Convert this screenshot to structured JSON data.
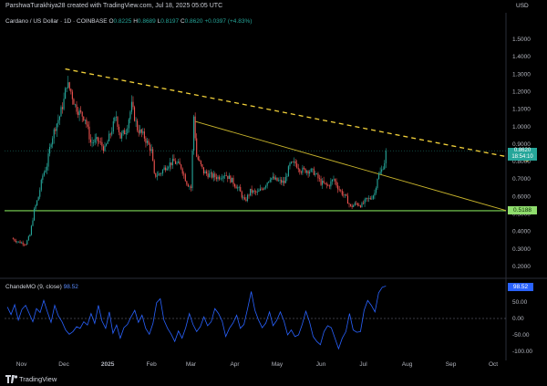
{
  "header": {
    "attribution": "ParshwaTurakhiya28 created with TradingView.com, Jul 18, 2025 05:05 UTC",
    "currency": "USD"
  },
  "legend": {
    "symbol": "Cardano / US Dollar · 1D · COINBASE",
    "o_label": "O",
    "o_value": "0.8225",
    "h_label": "H",
    "h_value": "0.8689",
    "l_label": "L",
    "l_value": "0.8197",
    "c_label": "C",
    "c_value": "0.8620",
    "change": "+0.0397 (+4.83%)"
  },
  "badges": {
    "price": "0.8620",
    "countdown": "18:54:10",
    "support": "0.5188",
    "osc": "98.52"
  },
  "oscillator": {
    "label": "ChandeMO (9, close)",
    "value": "98.52"
  },
  "footer": {
    "brand": "TradingView"
  },
  "colors": {
    "up": "#26a69a",
    "down": "#ef5350",
    "trend_dashed": "#f2d13a",
    "trend_solid": "#c9b52c",
    "support": "#7ed957",
    "osc_line": "#2962ff"
  },
  "chart_data": [
    {
      "type": "candlestick",
      "title": "Cardano / US Dollar · 1D · COINBASE",
      "y_axis_labels": [
        "1.5000",
        "1.4000",
        "1.3000",
        "1.2000",
        "1.1000",
        "1.0000",
        "0.9000",
        "0.8000",
        "0.7000",
        "0.6000",
        "0.5000",
        "0.4000",
        "0.3000",
        "0.2000"
      ],
      "ylim": [
        0.16,
        1.56
      ],
      "x_tick_labels": [
        "Nov",
        "Dec",
        "2025",
        "Feb",
        "Mar",
        "Apr",
        "May",
        "Jun",
        "Jul",
        "Aug",
        "Sep",
        "Oct"
      ],
      "close_path": [
        [
          "2024-10-25",
          0.36
        ],
        [
          "2024-10-30",
          0.34
        ],
        [
          "2024-11-04",
          0.33
        ],
        [
          "2024-11-07",
          0.38
        ],
        [
          "2024-11-10",
          0.52
        ],
        [
          "2024-11-13",
          0.6
        ],
        [
          "2024-11-16",
          0.72
        ],
        [
          "2024-11-19",
          0.78
        ],
        [
          "2024-11-22",
          0.92
        ],
        [
          "2024-11-25",
          1.0
        ],
        [
          "2024-11-28",
          1.06
        ],
        [
          "2024-12-01",
          1.15
        ],
        [
          "2024-12-03",
          1.25
        ],
        [
          "2024-12-06",
          1.2
        ],
        [
          "2024-12-09",
          1.12
        ],
        [
          "2024-12-12",
          1.08
        ],
        [
          "2024-12-16",
          1.05
        ],
        [
          "2024-12-20",
          0.91
        ],
        [
          "2024-12-25",
          0.92
        ],
        [
          "2024-12-30",
          0.87
        ],
        [
          "2025-01-03",
          0.96
        ],
        [
          "2025-01-07",
          1.06
        ],
        [
          "2025-01-10",
          0.94
        ],
        [
          "2025-01-14",
          0.98
        ],
        [
          "2025-01-18",
          1.12
        ],
        [
          "2025-01-22",
          0.99
        ],
        [
          "2025-01-27",
          0.94
        ],
        [
          "2025-02-01",
          0.86
        ],
        [
          "2025-02-03",
          0.72
        ],
        [
          "2025-02-07",
          0.73
        ],
        [
          "2025-02-12",
          0.78
        ],
        [
          "2025-02-17",
          0.8
        ],
        [
          "2025-02-22",
          0.77
        ],
        [
          "2025-02-26",
          0.68
        ],
        [
          "2025-03-01",
          0.65
        ],
        [
          "2025-03-03",
          1.06
        ],
        [
          "2025-03-05",
          0.83
        ],
        [
          "2025-03-10",
          0.74
        ],
        [
          "2025-03-15",
          0.72
        ],
        [
          "2025-03-20",
          0.71
        ],
        [
          "2025-03-25",
          0.73
        ],
        [
          "2025-03-30",
          0.69
        ],
        [
          "2025-04-04",
          0.64
        ],
        [
          "2025-04-08",
          0.57
        ],
        [
          "2025-04-12",
          0.63
        ],
        [
          "2025-04-17",
          0.62
        ],
        [
          "2025-04-22",
          0.66
        ],
        [
          "2025-04-26",
          0.71
        ],
        [
          "2025-05-01",
          0.69
        ],
        [
          "2025-05-06",
          0.68
        ],
        [
          "2025-05-10",
          0.78
        ],
        [
          "2025-05-14",
          0.79
        ],
        [
          "2025-05-18",
          0.75
        ],
        [
          "2025-05-23",
          0.75
        ],
        [
          "2025-05-27",
          0.74
        ],
        [
          "2025-06-01",
          0.68
        ],
        [
          "2025-06-06",
          0.66
        ],
        [
          "2025-06-10",
          0.7
        ],
        [
          "2025-06-14",
          0.64
        ],
        [
          "2025-06-19",
          0.59
        ],
        [
          "2025-06-22",
          0.54
        ],
        [
          "2025-06-26",
          0.56
        ],
        [
          "2025-06-30",
          0.55
        ],
        [
          "2025-07-03",
          0.58
        ],
        [
          "2025-07-06",
          0.59
        ],
        [
          "2025-07-09",
          0.62
        ],
        [
          "2025-07-11",
          0.71
        ],
        [
          "2025-07-14",
          0.75
        ],
        [
          "2025-07-16",
          0.8
        ],
        [
          "2025-07-17",
          0.86
        ]
      ],
      "trendlines": [
        {
          "style": "dashed",
          "from": [
            "2024-12-02",
            1.33
          ],
          "to": [
            "2025-10-28",
            0.8
          ]
        },
        {
          "style": "solid",
          "from": [
            "2025-03-04",
            1.03
          ],
          "to": [
            "2025-10-10",
            0.52
          ]
        }
      ],
      "hlines": [
        {
          "value": 0.5188
        }
      ],
      "last": 0.862
    },
    {
      "type": "line",
      "title": "ChandeMO (9, close)",
      "y_axis_labels": [
        "50.00",
        "0.00",
        "-50.00",
        "-100.00"
      ],
      "ylim": [
        -110,
        105
      ],
      "values": [
        35,
        12,
        42,
        -5,
        28,
        40,
        15,
        -10,
        30,
        18,
        55,
        20,
        -12,
        40,
        8,
        -10,
        -35,
        -48,
        -40,
        -25,
        -30,
        -10,
        -20,
        15,
        -15,
        40,
        -8,
        -30,
        20,
        -45,
        -20,
        -60,
        -28,
        -18,
        5,
        25,
        -12,
        10,
        -30,
        -48,
        -15,
        48,
        60,
        -5,
        -30,
        -48,
        -70,
        -38,
        -60,
        -28,
        15,
        -18,
        -40,
        -25,
        5,
        -22,
        -10,
        30,
        15,
        -8,
        -55,
        -30,
        -14,
        10,
        -30,
        -18,
        30,
        82,
        25,
        -5,
        -28,
        -14,
        20,
        -22,
        -6,
        20,
        -8,
        -50,
        -35,
        -55,
        -50,
        -18,
        22,
        -10,
        -55,
        -70,
        -80,
        -40,
        -22,
        -28,
        -60,
        -92,
        -60,
        -40,
        15,
        -35,
        -42,
        -40,
        25,
        55,
        40,
        20,
        78,
        95,
        98.52
      ]
    }
  ]
}
